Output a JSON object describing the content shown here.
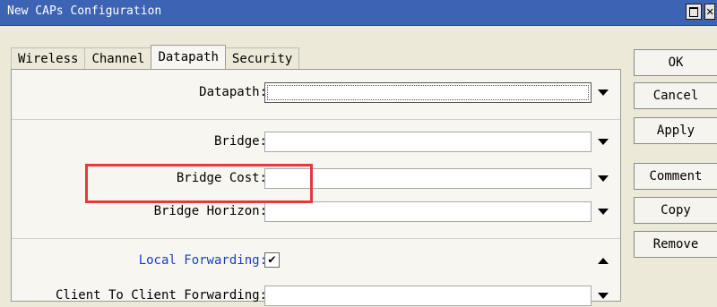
{
  "window": {
    "title": "New CAPs Configuration"
  },
  "tabs": [
    "Wireless",
    "Channel",
    "Datapath",
    "Security"
  ],
  "active_tab": "Datapath",
  "form": {
    "datapath_label": "Datapath:",
    "datapath_value": "",
    "bridge_label": "Bridge:",
    "bridge_value": "",
    "bridge_cost_label": "Bridge Cost:",
    "bridge_cost_value": "",
    "bridge_horizon_label": "Bridge Horizon:",
    "bridge_horizon_value": "",
    "local_forwarding_label": "Local Forwarding:",
    "local_forwarding_checked": true,
    "checkmark": "✔",
    "client_forwarding_label": "Client To Client Forwarding:",
    "client_forwarding_value": ""
  },
  "buttons": {
    "ok": "OK",
    "cancel": "Cancel",
    "apply": "Apply",
    "comment": "Comment",
    "copy": "Copy",
    "remove": "Remove"
  },
  "colors": {
    "titlebar": "#3d63b4",
    "highlight": "#e23b3b",
    "blue_label": "#1a3fbf"
  }
}
